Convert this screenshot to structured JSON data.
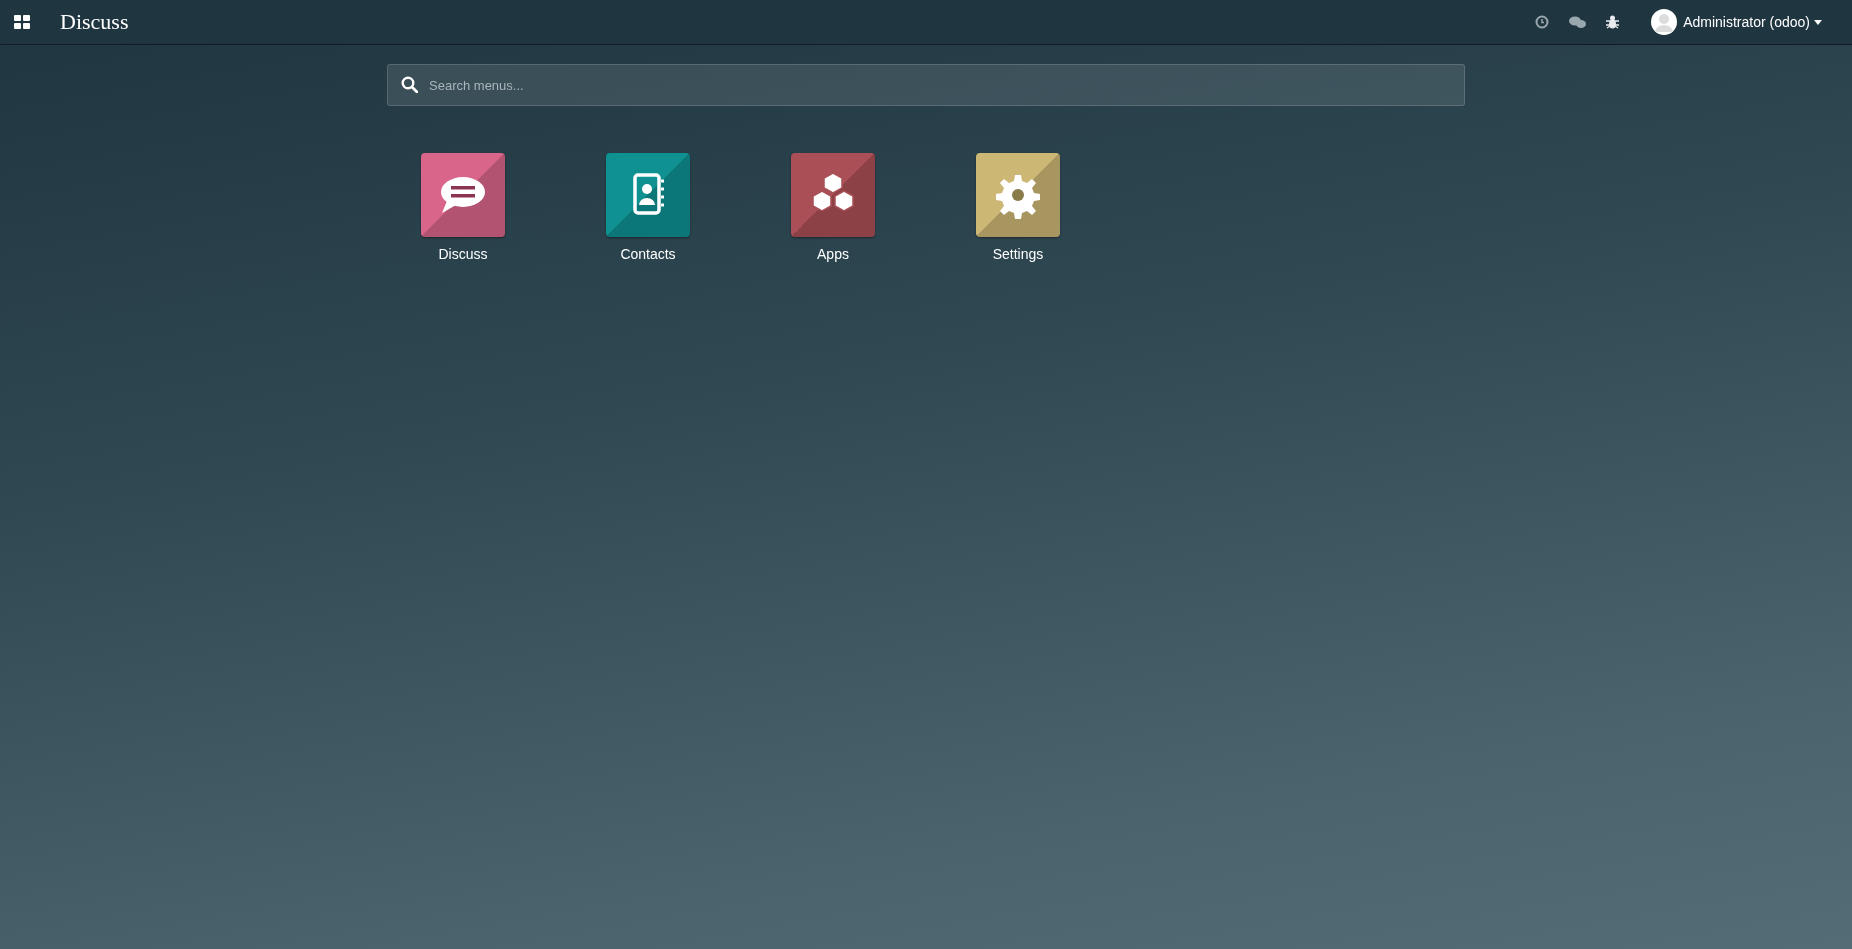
{
  "navbar": {
    "title": "Discuss",
    "user": "Administrator (odoo)"
  },
  "search": {
    "placeholder": "Search menus..."
  },
  "apps": [
    {
      "label": "Discuss",
      "kind": "discuss",
      "color": "#d9668a"
    },
    {
      "label": "Contacts",
      "kind": "contacts",
      "color": "#0f9192"
    },
    {
      "label": "Apps",
      "kind": "apps",
      "color": "#a94f55"
    },
    {
      "label": "Settings",
      "kind": "settings",
      "color": "#cdb775"
    }
  ]
}
